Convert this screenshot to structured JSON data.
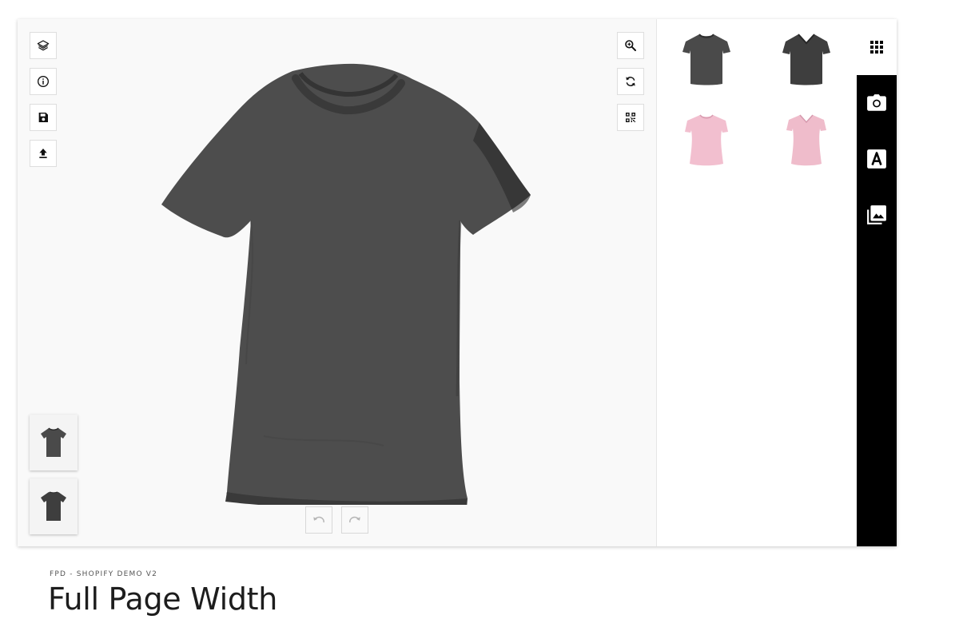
{
  "stage": {
    "left_tools": [
      {
        "name": "layers-icon",
        "title": "Manage Layers"
      },
      {
        "name": "info-icon",
        "title": "Info"
      },
      {
        "name": "save-icon",
        "title": "Save"
      },
      {
        "name": "upload-icon",
        "title": "Upload"
      }
    ],
    "right_tools": [
      {
        "name": "zoom-icon",
        "title": "Zoom"
      },
      {
        "name": "reset-icon",
        "title": "Reset"
      },
      {
        "name": "qr-code-icon",
        "title": "QR Code"
      }
    ],
    "product_color": "#4a4a4a",
    "views": [
      "front-view",
      "back-view"
    ],
    "undo_icon": "undo-icon",
    "redo_icon": "redo-icon"
  },
  "products_panel": {
    "items": [
      {
        "icon": "tshirt-crew-neck-dark",
        "color": "#4a4a4a"
      },
      {
        "icon": "tshirt-v-neck-dark",
        "color": "#3e3e3e"
      },
      {
        "icon": "tshirt-women-pink",
        "color": "#f2bfcf"
      },
      {
        "icon": "tshirt-women-vneck-pink",
        "color": "#efbccb"
      }
    ]
  },
  "navigation": {
    "items": [
      "grid-icon",
      "camera-icon",
      "text-icon",
      "images-icon"
    ],
    "bar_color": "#000000"
  },
  "page": {
    "breadcrumb": "FPD - SHOPIFY DEMO V2",
    "title": "Full Page Width"
  }
}
